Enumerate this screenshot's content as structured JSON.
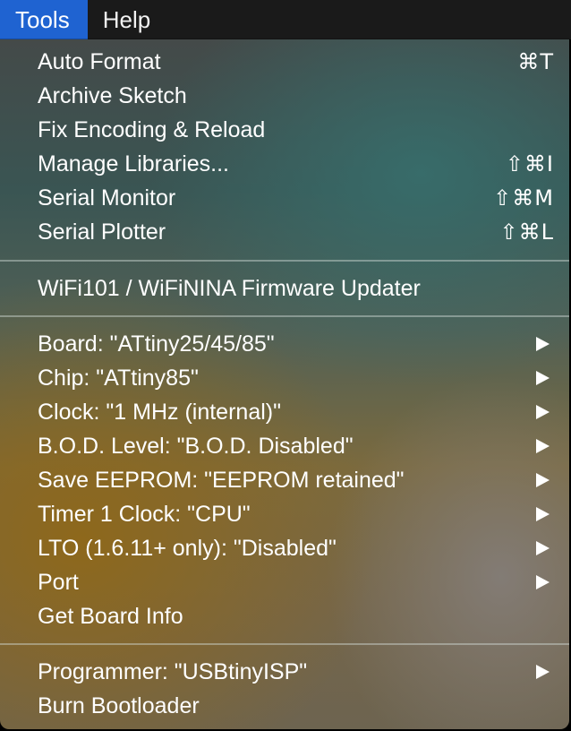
{
  "menubar": {
    "items": [
      {
        "label": "Tools"
      },
      {
        "label": "Help"
      }
    ]
  },
  "menu": {
    "auto_format": {
      "label": "Auto Format",
      "shortcut": "⌘T"
    },
    "archive_sketch": {
      "label": "Archive Sketch"
    },
    "fix_encoding": {
      "label": "Fix Encoding & Reload"
    },
    "manage_libraries": {
      "label": "Manage Libraries...",
      "shortcut": "⇧⌘I"
    },
    "serial_monitor": {
      "label": "Serial Monitor",
      "shortcut": "⇧⌘M"
    },
    "serial_plotter": {
      "label": "Serial Plotter",
      "shortcut": "⇧⌘L"
    },
    "firmware_updater": {
      "label": "WiFi101 / WiFiNINA Firmware Updater"
    },
    "board": {
      "label": "Board: \"ATtiny25/45/85\""
    },
    "chip": {
      "label": "Chip: \"ATtiny85\""
    },
    "clock": {
      "label": "Clock: \"1 MHz (internal)\""
    },
    "bod_level": {
      "label": "B.O.D. Level: \"B.O.D. Disabled\""
    },
    "save_eeprom": {
      "label": "Save EEPROM: \"EEPROM retained\""
    },
    "timer1_clock": {
      "label": "Timer 1 Clock: \"CPU\""
    },
    "lto": {
      "label": "LTO (1.6.11+ only): \"Disabled\""
    },
    "port": {
      "label": "Port"
    },
    "get_board_info": {
      "label": "Get Board Info"
    },
    "programmer": {
      "label": "Programmer: \"USBtinyISP\""
    },
    "burn_bootloader": {
      "label": "Burn Bootloader"
    }
  },
  "colors": {
    "menubar_bg": "#1a1a1a",
    "active_menu_bg": "#1f63d1",
    "menu_text": "#ffffff"
  },
  "icons": {
    "submenu": "submenu-arrow-icon"
  }
}
